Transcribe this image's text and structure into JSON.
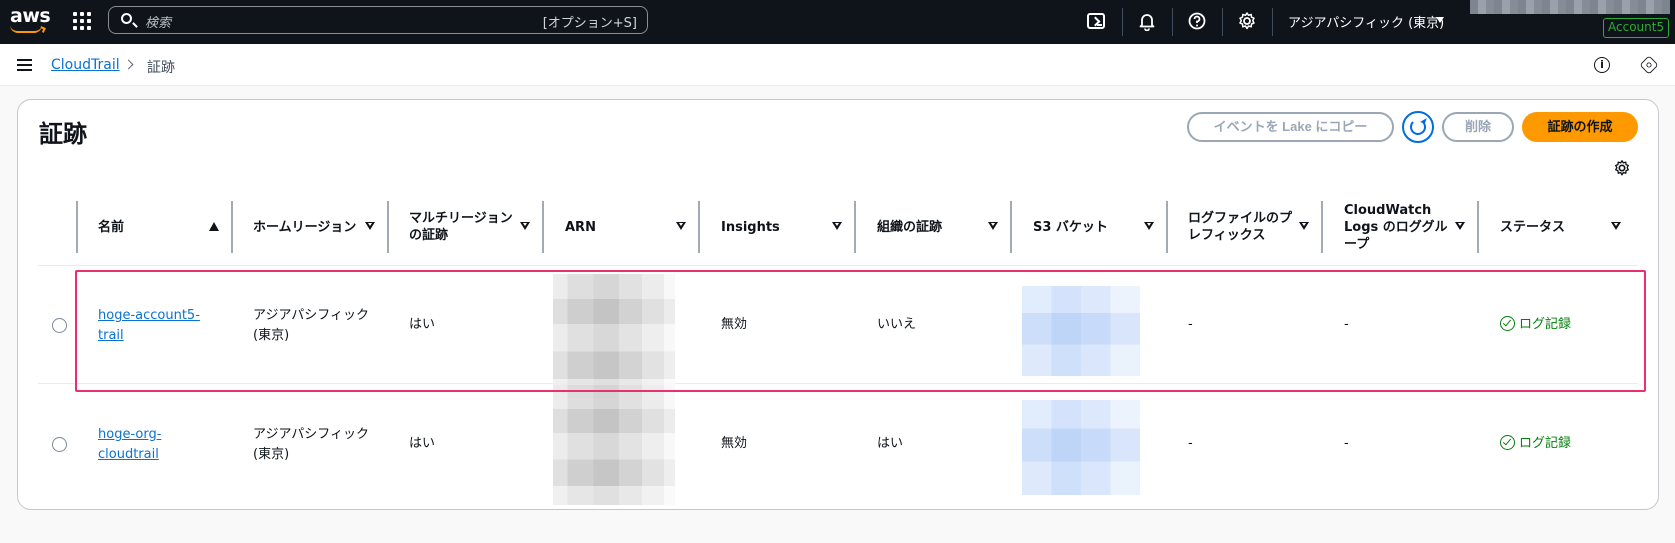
{
  "nav": {
    "logo": "aws",
    "search_placeholder": "検索",
    "search_shortcut": "[オプション+S]",
    "region": "アジアパシフィック (東京)",
    "account_badge": "Account5"
  },
  "breadcrumb": {
    "service": "CloudTrail",
    "current": "証跡"
  },
  "page": {
    "title": "証跡",
    "btn_copy": "イベントを Lake にコピー",
    "btn_delete": "削除",
    "btn_create": "証跡の作成"
  },
  "table": {
    "columns": [
      "名前",
      "ホームリージョン",
      "マルチリージョンの証跡",
      "ARN",
      "Insights",
      "組織の証跡",
      "S3 バケット",
      "ログファイルのプレフィックス",
      "CloudWatch Logs のロググループ",
      "ステータス"
    ],
    "rows": [
      {
        "name": "hoge-account5-trail",
        "home_region": "アジアパシフィック (東京)",
        "multi_region": "はい",
        "insights": "無効",
        "org_trail": "いいえ",
        "prefix": "-",
        "log_group": "-",
        "status": "ログ記録"
      },
      {
        "name": "hoge-org-cloudtrail",
        "home_region": "アジアパシフィック (東京)",
        "multi_region": "はい",
        "insights": "無効",
        "org_trail": "はい",
        "prefix": "-",
        "log_group": "-",
        "status": "ログ記録"
      }
    ]
  },
  "colors": {
    "accent": "#ff9900",
    "link": "#0972d3",
    "status_ok": "#037f0c",
    "highlight": "#e9306a",
    "nav_bg": "#0f141a"
  }
}
